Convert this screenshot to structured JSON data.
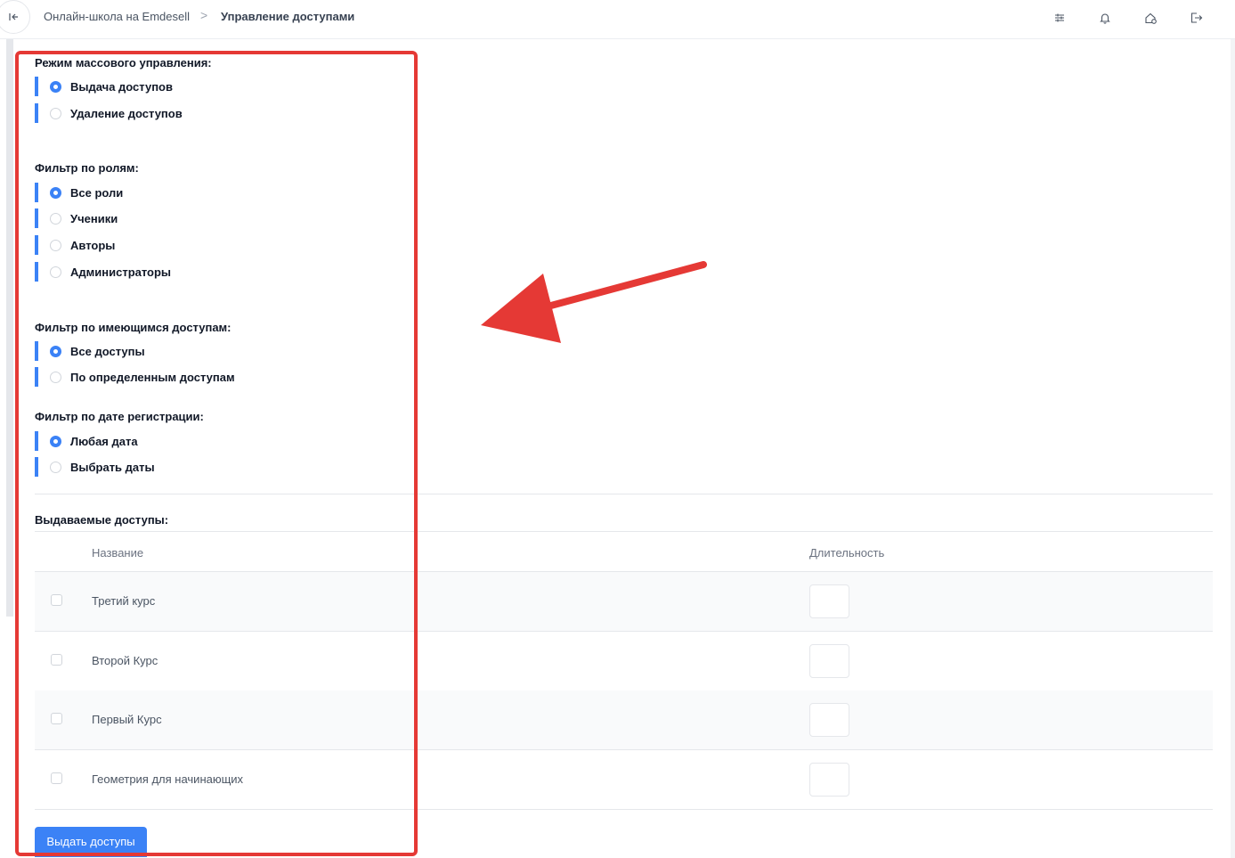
{
  "breadcrumb": {
    "school": "Онлайн-школа на Emdesell",
    "separator": ">",
    "current": "Управление доступами"
  },
  "header_icons": [
    "sliders-icon",
    "bell-icon",
    "home-settings-icon",
    "logout-icon"
  ],
  "mode_group": {
    "title": "Режим массового управления:",
    "options": [
      {
        "label": "Выдача доступов",
        "checked": true
      },
      {
        "label": "Удаление доступов",
        "checked": false
      }
    ]
  },
  "role_group": {
    "title": "Фильтр по ролям:",
    "options": [
      {
        "label": "Все роли",
        "checked": true
      },
      {
        "label": "Ученики",
        "checked": false
      },
      {
        "label": "Авторы",
        "checked": false
      },
      {
        "label": "Администраторы",
        "checked": false
      }
    ]
  },
  "access_group": {
    "title": "Фильтр по имеющимся доступам:",
    "options": [
      {
        "label": "Все доступы",
        "checked": true
      },
      {
        "label": "По определенным доступам",
        "checked": false
      }
    ]
  },
  "date_group": {
    "title": "Фильтр по дате регистрации:",
    "options": [
      {
        "label": "Любая дата",
        "checked": true
      },
      {
        "label": "Выбрать даты",
        "checked": false
      }
    ]
  },
  "accesses_table": {
    "title": "Выдаваемые доступы:",
    "columns": {
      "name": "Название",
      "duration": "Длительность"
    },
    "rows": [
      {
        "name": "Третий курс",
        "duration": ""
      },
      {
        "name": "Второй Курс",
        "duration": ""
      },
      {
        "name": "Первый Курс",
        "duration": ""
      },
      {
        "name": "Геометрия для начинающих",
        "duration": ""
      }
    ]
  },
  "submit_label": "Выдать доступы",
  "colors": {
    "accent": "#3b82f6",
    "annotation": "#e53935"
  }
}
